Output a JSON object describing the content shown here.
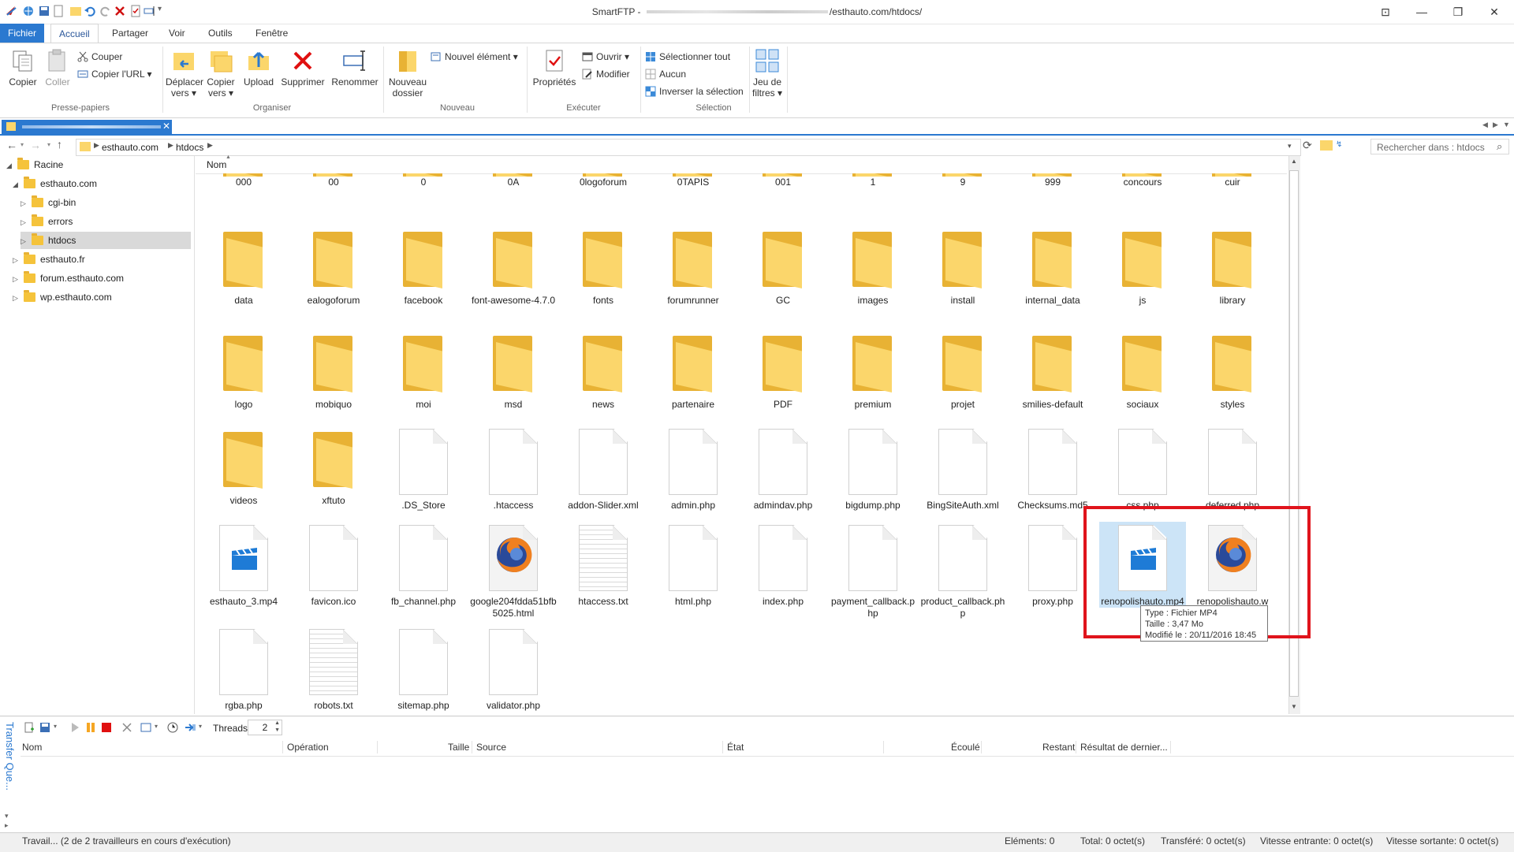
{
  "window": {
    "title_prefix": "SmartFTP - ",
    "title_suffix": "/esthauto.com/htdocs/",
    "controls": {
      "ribbon_toggle": "⊡",
      "minimize": "—",
      "restore": "❐",
      "close": "✕"
    }
  },
  "ribbon_tabs": [
    "Fichier",
    "Accueil",
    "Partager",
    "Voir",
    "Outils",
    "Fenêtre"
  ],
  "ribbon": {
    "copier": "Copier",
    "coller": "Coller",
    "couper": "Couper",
    "copier_url": "Copier l'URL ▾",
    "presse_papiers": "Presse-papiers",
    "deplacer": [
      "Déplacer",
      "vers ▾"
    ],
    "copier_vers": [
      "Copier",
      "vers ▾"
    ],
    "upload": "Upload",
    "supprimer": "Supprimer",
    "renommer": "Renommer",
    "organiser": "Organiser",
    "nouveau_dossier": [
      "Nouveau",
      "dossier"
    ],
    "nouvel_element": "Nouvel élément ▾",
    "nouveau": "Nouveau",
    "proprietes": "Propriétés",
    "ouvrir": "Ouvrir ▾",
    "modifier": "Modifier",
    "executer": "Exécuter",
    "selectionner_tout": "Sélectionner tout",
    "aucun": "Aucun",
    "inverser": "Inverser la sélection",
    "selection": "Sélection",
    "jeu_filtres": [
      "Jeu de",
      "filtres ▾"
    ]
  },
  "address": {
    "crumbs": [
      "esthauto.com",
      "htdocs"
    ],
    "search_placeholder": "Rechercher dans : htdocs"
  },
  "tree": [
    {
      "label": "Racine",
      "expanded": true
    },
    {
      "label": "esthauto.com",
      "expanded": true
    },
    {
      "label": "cgi-bin"
    },
    {
      "label": "errors"
    },
    {
      "label": "htdocs",
      "selected": true
    },
    {
      "label": "esthauto.fr"
    },
    {
      "label": "forum.esthauto.com"
    },
    {
      "label": "wp.esthauto.com"
    }
  ],
  "column_header": "Nom",
  "files": [
    {
      "name": "000",
      "kind": "folder-partial"
    },
    {
      "name": "00",
      "kind": "folder-partial"
    },
    {
      "name": "0",
      "kind": "folder-partial"
    },
    {
      "name": "0A",
      "kind": "folder-partial"
    },
    {
      "name": "0logoforum",
      "kind": "folder-partial"
    },
    {
      "name": "0TAPIS",
      "kind": "folder-partial"
    },
    {
      "name": "001",
      "kind": "folder-partial"
    },
    {
      "name": "1",
      "kind": "folder-partial"
    },
    {
      "name": "9",
      "kind": "folder-partial"
    },
    {
      "name": "999",
      "kind": "folder-partial"
    },
    {
      "name": "concours",
      "kind": "folder-partial"
    },
    {
      "name": "cuir",
      "kind": "folder-partial"
    },
    {
      "name": "data",
      "kind": "folder"
    },
    {
      "name": "ealogoforum",
      "kind": "folder"
    },
    {
      "name": "facebook",
      "kind": "folder"
    },
    {
      "name": "font-awesome-4.7.0",
      "kind": "folder"
    },
    {
      "name": "fonts",
      "kind": "folder"
    },
    {
      "name": "forumrunner",
      "kind": "folder"
    },
    {
      "name": "GC",
      "kind": "folder"
    },
    {
      "name": "images",
      "kind": "folder"
    },
    {
      "name": "install",
      "kind": "folder"
    },
    {
      "name": "internal_data",
      "kind": "folder"
    },
    {
      "name": "js",
      "kind": "folder"
    },
    {
      "name": "library",
      "kind": "folder"
    },
    {
      "name": "logo",
      "kind": "folder"
    },
    {
      "name": "mobiquo",
      "kind": "folder"
    },
    {
      "name": "moi",
      "kind": "folder"
    },
    {
      "name": "msd",
      "kind": "folder"
    },
    {
      "name": "news",
      "kind": "folder"
    },
    {
      "name": "partenaire",
      "kind": "folder"
    },
    {
      "name": "PDF",
      "kind": "folder"
    },
    {
      "name": "premium",
      "kind": "folder"
    },
    {
      "name": "projet",
      "kind": "folder"
    },
    {
      "name": "smilies-default",
      "kind": "folder"
    },
    {
      "name": "sociaux",
      "kind": "folder"
    },
    {
      "name": "styles",
      "kind": "folder"
    },
    {
      "name": "videos",
      "kind": "folder"
    },
    {
      "name": "xftuto",
      "kind": "folder"
    },
    {
      "name": ".DS_Store",
      "kind": "doc"
    },
    {
      "name": ".htaccess",
      "kind": "doc"
    },
    {
      "name": "addon-Slider.xml",
      "kind": "doc"
    },
    {
      "name": "admin.php",
      "kind": "doc"
    },
    {
      "name": "admindav.php",
      "kind": "doc"
    },
    {
      "name": "bigdump.php",
      "kind": "doc"
    },
    {
      "name": "BingSiteAuth.xml",
      "kind": "doc"
    },
    {
      "name": "Checksums.md5",
      "kind": "doc"
    },
    {
      "name": "css.php",
      "kind": "doc"
    },
    {
      "name": "deferred.php",
      "kind": "doc"
    },
    {
      "name": "esthauto_3.mp4",
      "kind": "video"
    },
    {
      "name": "favicon.ico",
      "kind": "doc"
    },
    {
      "name": "fb_channel.php",
      "kind": "doc"
    },
    {
      "name": "google204fdda51bfb5025.html",
      "kind": "firefox"
    },
    {
      "name": "htaccess.txt",
      "kind": "text"
    },
    {
      "name": "html.php",
      "kind": "doc"
    },
    {
      "name": "index.php",
      "kind": "doc"
    },
    {
      "name": "payment_callback.php",
      "kind": "doc"
    },
    {
      "name": "product_callback.php",
      "kind": "doc"
    },
    {
      "name": "proxy.php",
      "kind": "doc"
    },
    {
      "name": "renopolishauto.mp4",
      "kind": "video",
      "selected": true
    },
    {
      "name": "renopolishauto.w",
      "kind": "firefox"
    },
    {
      "name": "rgba.php",
      "kind": "doc"
    },
    {
      "name": "robots.txt",
      "kind": "text"
    },
    {
      "name": "sitemap.php",
      "kind": "doc"
    },
    {
      "name": "validator.php",
      "kind": "doc"
    }
  ],
  "tooltip": [
    "Type : Fichier MP4",
    "Taille : 3,47 Mo",
    "Modifié le : 20/11/2016 18:45"
  ],
  "transfer": {
    "panel_label": "Transfer Que...",
    "threads_label": "Threads",
    "threads_value": "2",
    "columns": [
      "Nom",
      "Opération",
      "Taille",
      "Source",
      "État",
      "Écoulé",
      "Restant",
      "Résultat de dernier..."
    ]
  },
  "status": {
    "workers": "Travail... (2 de 2 travailleurs en cours d'exécution)",
    "elements": "Eléments: 0",
    "total": "Total: 0 octet(s)",
    "transferred": "Transféré: 0 octet(s)",
    "incoming": "Vitesse entrante: 0 octet(s)",
    "outgoing": "Vitesse sortante: 0 octet(s)"
  },
  "colors": {
    "accent": "#2b79d0",
    "highlight_box": "#e0141c",
    "folder": "#fbd66b",
    "selection": "#cce4f7"
  }
}
